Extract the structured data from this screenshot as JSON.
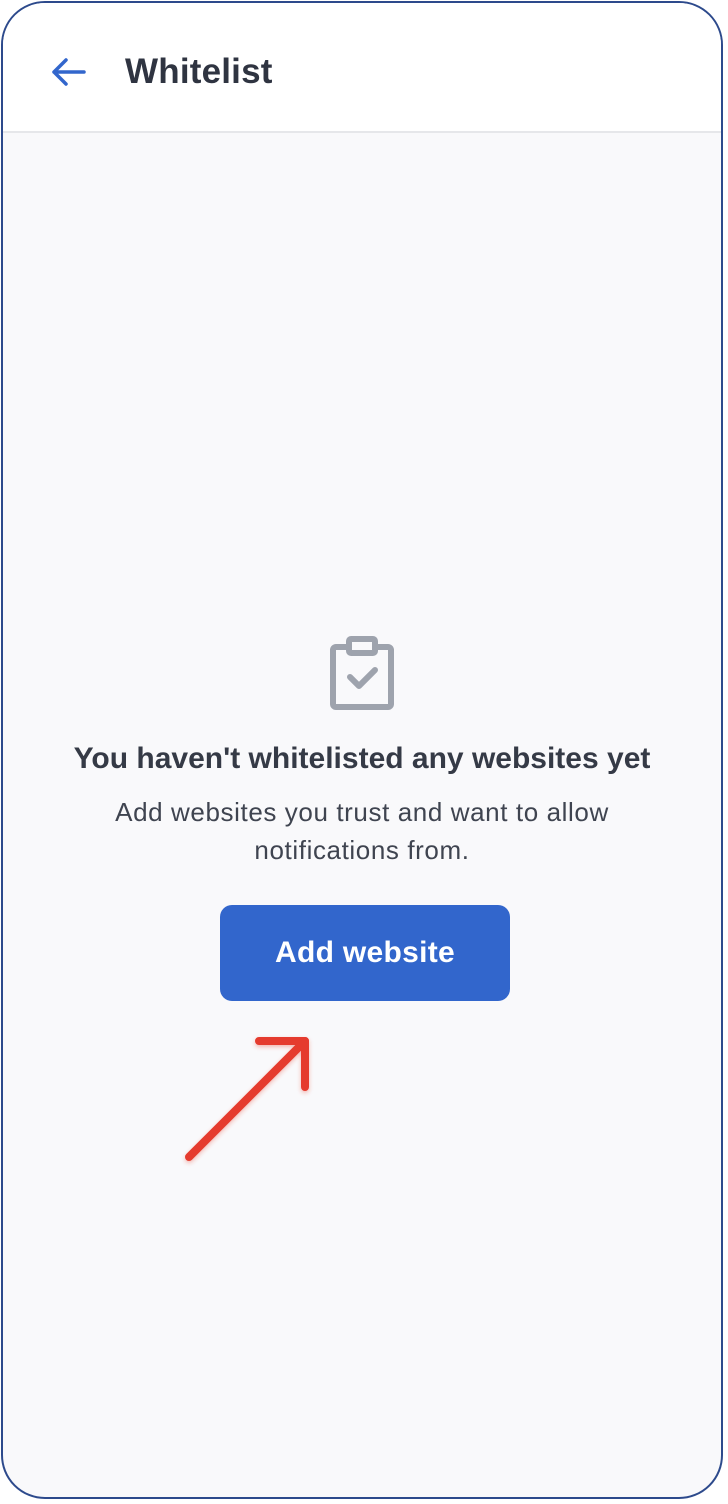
{
  "header": {
    "back_icon": "arrow-left-icon",
    "title": "Whitelist"
  },
  "empty_state": {
    "icon": "clipboard-check-icon",
    "heading": "You haven't whitelisted any websites yet",
    "description": "Add websites you trust and want to allow notifications from."
  },
  "actions": {
    "add_website_label": "Add website"
  },
  "colors": {
    "primary": "#3266cc",
    "frame": "#2d4a8c",
    "annotation_arrow": "#e53a2f",
    "icon_gray": "#9ea3ad"
  }
}
